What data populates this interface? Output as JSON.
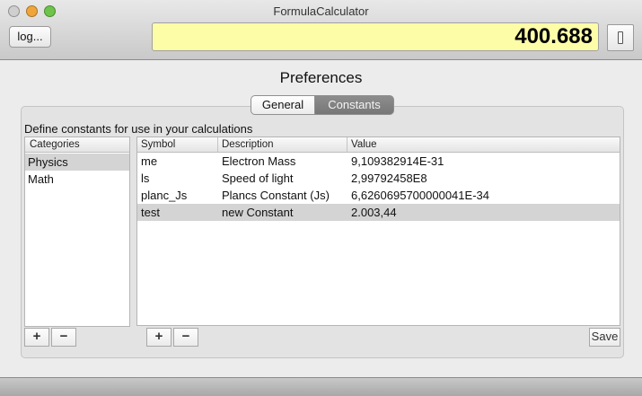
{
  "window": {
    "title": "FormulaCalculator"
  },
  "toolbar": {
    "log_label": "log...",
    "display_value": "400.688",
    "toggle_icon": "switch-icon"
  },
  "preferences": {
    "title": "Preferences",
    "tabs": [
      {
        "label": "General",
        "selected": false
      },
      {
        "label": "Constants",
        "selected": true
      }
    ],
    "description": "Define constants for use in your calculations",
    "categories": {
      "header": "Categories",
      "items": [
        "Physics",
        "Math"
      ],
      "selected": "Physics"
    },
    "constants": {
      "headers": [
        "Symbol",
        "Description",
        "Value"
      ],
      "rows": [
        [
          "me",
          "Electron Mass",
          "9,109382914E-31"
        ],
        [
          "ls",
          "Speed of light",
          "2,99792458E8"
        ],
        [
          "planc_Js",
          "Plancs Constant (Js)",
          "6,6260695700000041E-34"
        ],
        [
          "test",
          "new Constant",
          "2.003,44"
        ]
      ],
      "selected_row": 3
    },
    "add_label": "+",
    "remove_label": "−",
    "save_label": "Save"
  }
}
